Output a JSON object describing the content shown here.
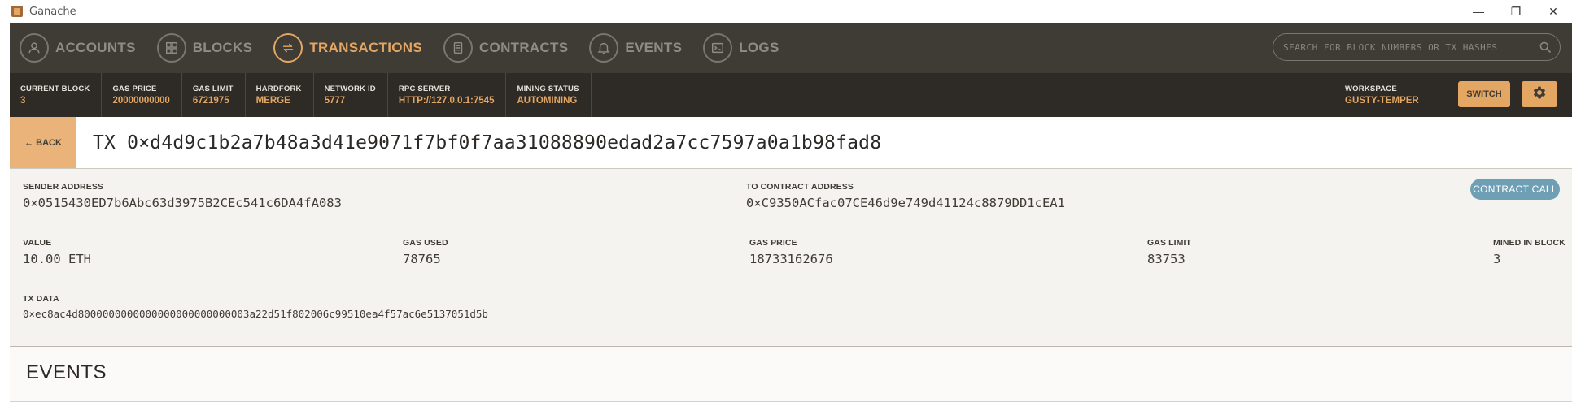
{
  "window": {
    "title": "Ganache"
  },
  "nav": {
    "items": [
      {
        "label": "ACCOUNTS",
        "icon": "user-icon",
        "active": false
      },
      {
        "label": "BLOCKS",
        "icon": "blocks-icon",
        "active": false
      },
      {
        "label": "TRANSACTIONS",
        "icon": "swap-icon",
        "active": true
      },
      {
        "label": "CONTRACTS",
        "icon": "document-icon",
        "active": false
      },
      {
        "label": "EVENTS",
        "icon": "bell-icon",
        "active": false
      },
      {
        "label": "LOGS",
        "icon": "terminal-icon",
        "active": false
      }
    ],
    "search_placeholder": "SEARCH FOR BLOCK NUMBERS OR TX HASHES"
  },
  "stats": {
    "current_block": {
      "label": "CURRENT BLOCK",
      "value": "3"
    },
    "gas_price": {
      "label": "GAS PRICE",
      "value": "20000000000"
    },
    "gas_limit": {
      "label": "GAS LIMIT",
      "value": "6721975"
    },
    "hardfork": {
      "label": "HARDFORK",
      "value": "MERGE"
    },
    "network_id": {
      "label": "NETWORK ID",
      "value": "5777"
    },
    "rpc_server": {
      "label": "RPC SERVER",
      "value": "HTTP://127.0.0.1:7545"
    },
    "mining_status": {
      "label": "MINING STATUS",
      "value": "AUTOMINING"
    },
    "workspace": {
      "label": "WORKSPACE",
      "value": "GUSTY-TEMPER"
    },
    "switch_label": "SWITCH"
  },
  "tx": {
    "back_label": "← BACK",
    "title": "TX 0×d4d9c1b2a7b48a3d41e9071f7bf0f7aa31088890edad2a7cc7597a0a1b98fad8",
    "sender": {
      "label": "SENDER ADDRESS",
      "value": "0×0515430ED7b6Abc63d3975B2CEc541c6DA4fA083"
    },
    "to_contract": {
      "label": "TO CONTRACT ADDRESS",
      "value": "0×C9350ACfac07CE46d9e749d41124c8879DD1cEA1"
    },
    "badge": "CONTRACT CALL",
    "value": {
      "label": "VALUE",
      "value": "10.00 ETH"
    },
    "gas_used": {
      "label": "GAS USED",
      "value": "78765"
    },
    "gas_price": {
      "label": "GAS PRICE",
      "value": "18733162676"
    },
    "gas_limit": {
      "label": "GAS LIMIT",
      "value": "83753"
    },
    "mined_in_block": {
      "label": "MINED IN BLOCK",
      "value": "3"
    },
    "tx_data": {
      "label": "TX DATA",
      "value": "0×ec8ac4d8000000000000000000000000003a22d51f802006c99510ea4f57ac6e5137051d5b"
    }
  },
  "events": {
    "title": "EVENTS"
  },
  "colors": {
    "accent": "#e4a663",
    "nav_bg": "#3f3b35",
    "stats_bg": "#2e2b27",
    "badge": "#6f9fb5"
  }
}
